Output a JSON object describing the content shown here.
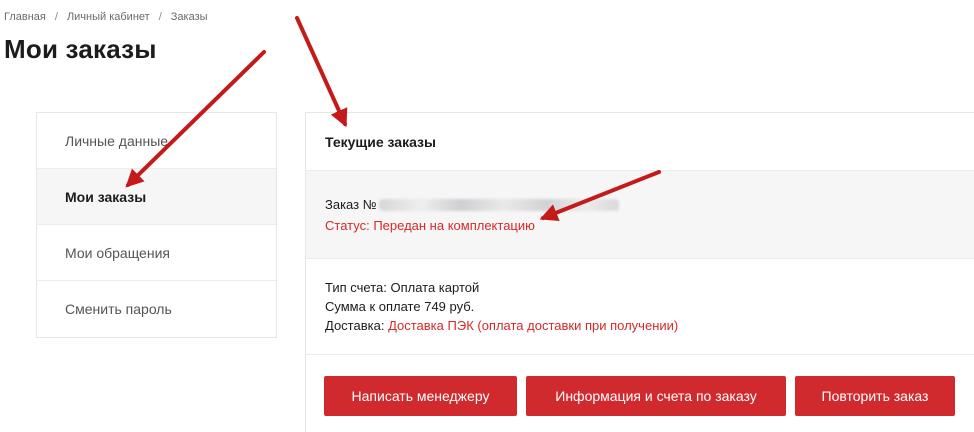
{
  "breadcrumb": {
    "items": [
      "Главная",
      "Личный кабинет",
      "Заказы"
    ],
    "separator": "/"
  },
  "page_title": "Мои заказы",
  "sidebar": {
    "items": [
      {
        "label": "Личные данные",
        "active": false
      },
      {
        "label": "Мои заказы",
        "active": true
      },
      {
        "label": "Мои обращения",
        "active": false
      },
      {
        "label": "Сменить пароль",
        "active": false
      }
    ]
  },
  "main": {
    "panel_title": "Текущие заказы",
    "order": {
      "number_prefix": "Заказ №",
      "status": "Статус: Передан на комплектацию",
      "payment_type": "Тип счета: Оплата картой",
      "amount": "Сумма к оплате 749 руб.",
      "delivery_label": "Доставка: ",
      "delivery_value": "Доставка ПЭК (оплата доставки при получении)"
    },
    "buttons": {
      "write_manager": "Написать менеджеру",
      "order_info": "Информация и счета по заказу",
      "repeat_order": "Повторить заказ"
    }
  },
  "colors": {
    "accent": "#d12a2e",
    "status_red": "#d42a2a",
    "annotation_arrow": "#c41a1a",
    "active_bg": "#f6f6f7"
  }
}
